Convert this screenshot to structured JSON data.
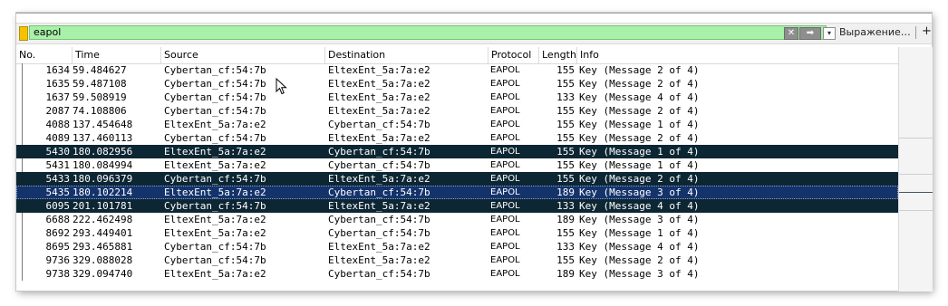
{
  "filter": {
    "value": "eapol",
    "clear_icon": "✕",
    "apply_icon": "➡",
    "dropdown_icon": "▾",
    "expression_label": "Выражение…",
    "add_icon": "+"
  },
  "columns": [
    "No.",
    "Time",
    "Source",
    "Destination",
    "Protocol",
    "Length",
    "Info"
  ],
  "rows": [
    {
      "no": "1634",
      "time": "59.484627",
      "src": "Cybertan_cf:54:7b",
      "dst": "EltexEnt_5a:7a:e2",
      "proto": "EAPOL",
      "len": "155",
      "info": "Key (Message 2 of 4)"
    },
    {
      "no": "1635",
      "time": "59.487108",
      "src": "Cybertan_cf:54:7b",
      "dst": "EltexEnt_5a:7a:e2",
      "proto": "EAPOL",
      "len": "155",
      "info": "Key (Message 2 of 4)"
    },
    {
      "no": "1637",
      "time": "59.508919",
      "src": "Cybertan_cf:54:7b",
      "dst": "EltexEnt_5a:7a:e2",
      "proto": "EAPOL",
      "len": "133",
      "info": "Key (Message 4 of 4)"
    },
    {
      "no": "2087",
      "time": "74.108806",
      "src": "Cybertan_cf:54:7b",
      "dst": "EltexEnt_5a:7a:e2",
      "proto": "EAPOL",
      "len": "155",
      "info": "Key (Message 2 of 4)"
    },
    {
      "no": "4088",
      "time": "137.454648",
      "src": "EltexEnt_5a:7a:e2",
      "dst": "Cybertan_cf:54:7b",
      "proto": "EAPOL",
      "len": "155",
      "info": "Key (Message 1 of 4)"
    },
    {
      "no": "4089",
      "time": "137.460113",
      "src": "Cybertan_cf:54:7b",
      "dst": "EltexEnt_5a:7a:e2",
      "proto": "EAPOL",
      "len": "155",
      "info": "Key (Message 2 of 4)"
    },
    {
      "no": "5430",
      "time": "180.082956",
      "src": "EltexEnt_5a:7a:e2",
      "dst": "Cybertan_cf:54:7b",
      "proto": "EAPOL",
      "len": "155",
      "info": "Key (Message 1 of 4)",
      "state": "sel"
    },
    {
      "no": "5431",
      "time": "180.084994",
      "src": "EltexEnt_5a:7a:e2",
      "dst": "Cybertan_cf:54:7b",
      "proto": "EAPOL",
      "len": "155",
      "info": "Key (Message 1 of 4)"
    },
    {
      "no": "5433",
      "time": "180.096379",
      "src": "Cybertan_cf:54:7b",
      "dst": "EltexEnt_5a:7a:e2",
      "proto": "EAPOL",
      "len": "155",
      "info": "Key (Message 2 of 4)",
      "state": "sel"
    },
    {
      "no": "5435",
      "time": "180.102214",
      "src": "EltexEnt_5a:7a:e2",
      "dst": "Cybertan_cf:54:7b",
      "proto": "EAPOL",
      "len": "189",
      "info": "Key (Message 3 of 4)",
      "state": "cur"
    },
    {
      "no": "6095",
      "time": "201.101781",
      "src": "Cybertan_cf:54:7b",
      "dst": "EltexEnt_5a:7a:e2",
      "proto": "EAPOL",
      "len": "133",
      "info": "Key (Message 4 of 4)",
      "state": "sel"
    },
    {
      "no": "6688",
      "time": "222.462498",
      "src": "EltexEnt_5a:7a:e2",
      "dst": "Cybertan_cf:54:7b",
      "proto": "EAPOL",
      "len": "189",
      "info": "Key (Message 3 of 4)"
    },
    {
      "no": "8692",
      "time": "293.449401",
      "src": "EltexEnt_5a:7a:e2",
      "dst": "Cybertan_cf:54:7b",
      "proto": "EAPOL",
      "len": "155",
      "info": "Key (Message 1 of 4)"
    },
    {
      "no": "8695",
      "time": "293.465881",
      "src": "Cybertan_cf:54:7b",
      "dst": "EltexEnt_5a:7a:e2",
      "proto": "EAPOL",
      "len": "133",
      "info": "Key (Message 4 of 4)"
    },
    {
      "no": "9736",
      "time": "329.088028",
      "src": "Cybertan_cf:54:7b",
      "dst": "EltexEnt_5a:7a:e2",
      "proto": "EAPOL",
      "len": "155",
      "info": "Key (Message 2 of 4)"
    },
    {
      "no": "9738",
      "time": "329.094740",
      "src": "EltexEnt_5a:7a:e2",
      "dst": "Cybertan_cf:54:7b",
      "proto": "EAPOL",
      "len": "189",
      "info": "Key (Message 3 of 4)"
    }
  ]
}
